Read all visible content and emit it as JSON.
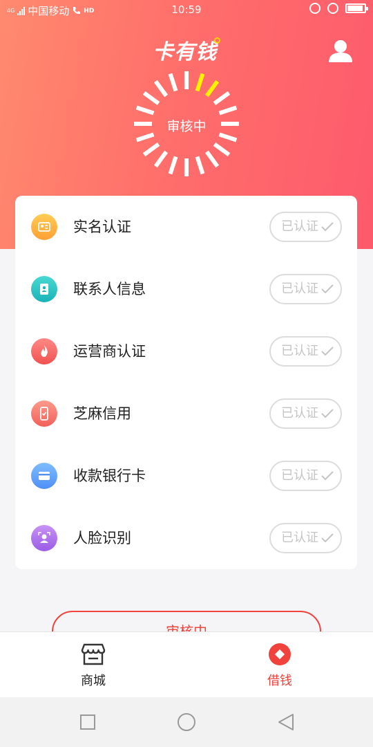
{
  "status_bar": {
    "carrier": "中国移动",
    "network": "4G",
    "hd": "HD",
    "time": "10:59",
    "battery_level": 0.9
  },
  "header": {
    "brand_name": "卡有钱",
    "status_label": "审核中",
    "profile_icon": "person-icon"
  },
  "verification": {
    "items": [
      {
        "label": "实名认证",
        "status": "已认证",
        "icon": "id-card-icon",
        "color_top": "#ffcd55",
        "color_bottom": "#ff9f33"
      },
      {
        "label": "联系人信息",
        "status": "已认证",
        "icon": "contacts-book-icon",
        "color_top": "#4ad8d2",
        "color_bottom": "#19b3b6"
      },
      {
        "label": "运营商认证",
        "status": "已认证",
        "icon": "flame-icon",
        "color_top": "#ff8a86",
        "color_bottom": "#f0524f"
      },
      {
        "label": "芝麻信用",
        "status": "已认证",
        "icon": "mobile-check-icon",
        "color_top": "#ff9a8a",
        "color_bottom": "#f0615a"
      },
      {
        "label": "收款银行卡",
        "status": "已认证",
        "icon": "bank-card-icon",
        "color_top": "#7dbdff",
        "color_bottom": "#4f8ff7"
      },
      {
        "label": "人脸识别",
        "status": "已认证",
        "icon": "face-recognition-icon",
        "color_top": "#c792f5",
        "color_bottom": "#9a5ce6"
      }
    ]
  },
  "review_button": {
    "label": "审核中"
  },
  "tab_bar": {
    "tabs": [
      {
        "label": "商城",
        "icon": "store-icon",
        "active": false
      },
      {
        "label": "借钱",
        "icon": "borrow-icon",
        "active": true
      }
    ],
    "active_color": "#f0433d"
  },
  "colors": {
    "hero_gradient_start": "#ff8a6e",
    "hero_gradient_end": "#fd5a6c",
    "accent": "#f0433d",
    "spinner_highlight": "#fff200"
  }
}
